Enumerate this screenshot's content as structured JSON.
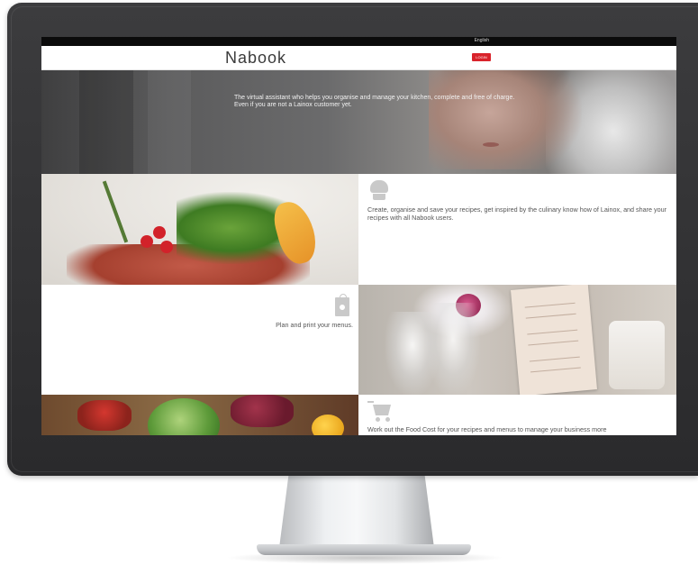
{
  "topbar": {
    "language": "English"
  },
  "header": {
    "logo": "Nabook",
    "login_label": "LOGIN"
  },
  "hero": {
    "text": "The virtual assistant who helps you organise and manage your kitchen, complete and free of charge. Even if you are not a Lainox customer yet."
  },
  "features": {
    "recipes": {
      "icon": "chef-hat-icon",
      "text": "Create, organise and save your recipes, get inspired by the culinary know how of Lainox, and share your recipes with all Nabook users."
    },
    "menus": {
      "icon": "menu-card-icon",
      "text": "Plan and print your menus."
    },
    "food_cost": {
      "icon": "shopping-cart-icon",
      "text": "Work out the Food Cost for your recipes and menus to manage your business more"
    }
  },
  "colors": {
    "accent": "#d9232b",
    "monitor_bezel": "#2f2f31",
    "topbar": "#0b0b0b",
    "icon_grey": "#c9c9c9"
  }
}
